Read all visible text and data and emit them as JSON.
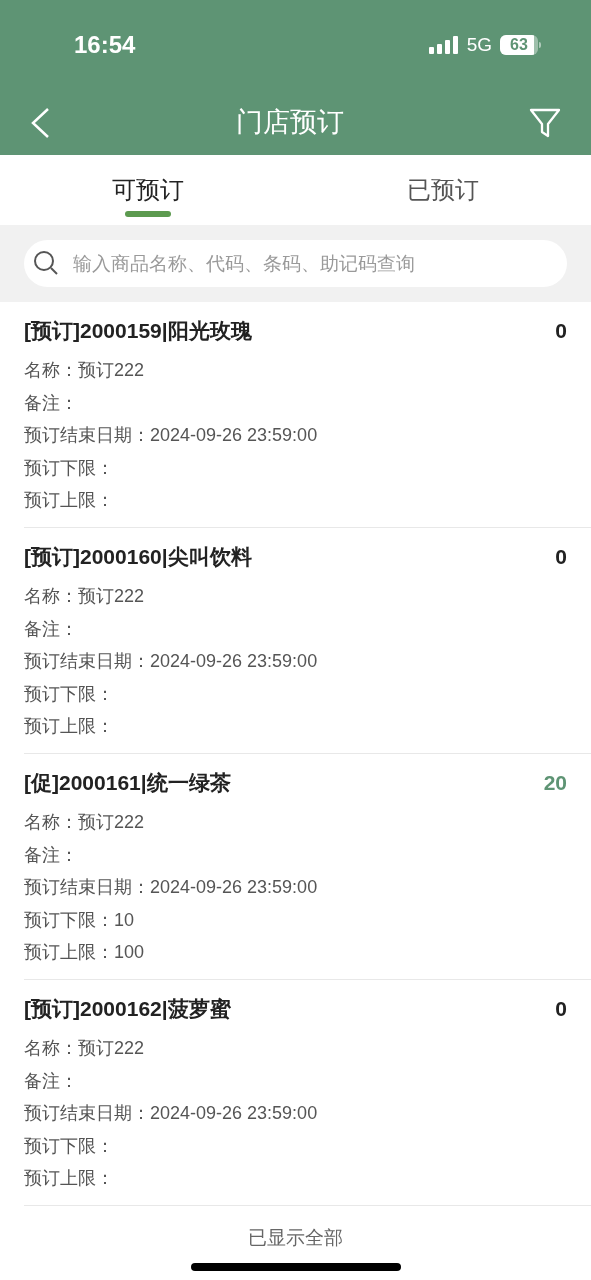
{
  "status_bar": {
    "time": "16:54",
    "network": "5G",
    "battery": "63"
  },
  "header": {
    "title": "门店预订"
  },
  "tabs": [
    {
      "label": "可预订",
      "selected": true
    },
    {
      "label": "已预订",
      "selected": false
    }
  ],
  "search": {
    "placeholder": "输入商品名称、代码、条码、助记码查询"
  },
  "items": [
    {
      "title": "[预订]2000159|阳光玫瑰",
      "quantity": "0",
      "highlighted": false,
      "lines": [
        "名称：预订222",
        "备注：",
        "预订结束日期：2024-09-26 23:59:00",
        "预订下限：",
        "预订上限："
      ]
    },
    {
      "title": "[预订]2000160|尖叫饮料",
      "quantity": "0",
      "highlighted": false,
      "lines": [
        "名称：预订222",
        "备注：",
        "预订结束日期：2024-09-26 23:59:00",
        "预订下限：",
        "预订上限："
      ]
    },
    {
      "title": "[促]2000161|统一绿茶",
      "quantity": "20",
      "highlighted": true,
      "lines": [
        "名称：预订222",
        "备注：",
        "预订结束日期：2024-09-26 23:59:00",
        "预订下限：10",
        "预订上限：100"
      ]
    },
    {
      "title": "[预订]2000162|菠萝蜜",
      "quantity": "0",
      "highlighted": false,
      "lines": [
        "名称：预订222",
        "备注：",
        "预订结束日期：2024-09-26 23:59:00",
        "预订下限：",
        "预订上限："
      ]
    }
  ],
  "footer": {
    "text": "已显示全部"
  }
}
